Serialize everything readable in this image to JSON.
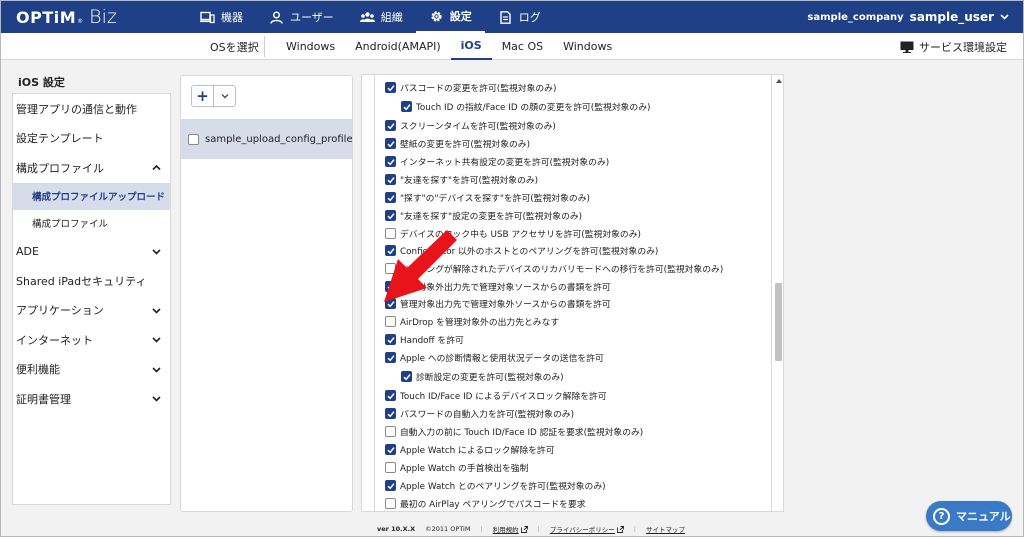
{
  "brand": {
    "optim": "OPTiM",
    "tm": "®",
    "biz": "Biz"
  },
  "nav": [
    {
      "label": "機器",
      "icon": "device-icon"
    },
    {
      "label": "ユーザー",
      "icon": "user-icon"
    },
    {
      "label": "組織",
      "icon": "organization-icon"
    },
    {
      "label": "設定",
      "icon": "gear-icon",
      "active": true
    },
    {
      "label": "ログ",
      "icon": "document-icon"
    }
  ],
  "account": {
    "company": "sample_company",
    "user": "sample_user"
  },
  "subnav": {
    "os_select_label": "OSを選択",
    "tabs": [
      "Windows",
      "Android(AMAPI)",
      "iOS",
      "Mac OS",
      "Windows"
    ],
    "active_tab": "iOS",
    "service_settings": "サービス環境設定"
  },
  "sidebar": {
    "title": "iOS 設定",
    "items": [
      {
        "label": "管理アプリの通信と動作"
      },
      {
        "label": "設定テンプレート"
      },
      {
        "label": "構成プロファイル",
        "expanded": true
      },
      {
        "label": "構成プロファイルアップロード",
        "sub": true,
        "active": true
      },
      {
        "label": "構成プロファイル",
        "sub": true
      },
      {
        "label": "ADE"
      },
      {
        "label": "Shared iPadセキュリティ"
      },
      {
        "label": "アプリケーション"
      },
      {
        "label": "インターネット"
      },
      {
        "label": "便利機能"
      },
      {
        "label": "証明書管理"
      }
    ]
  },
  "files": {
    "add_label": "+",
    "items": [
      {
        "name": "sample_upload_config_profile",
        "checked": false
      }
    ]
  },
  "options": [
    {
      "label": "パスコードの変更を許可(監視対象のみ)",
      "checked": true,
      "indent": 0
    },
    {
      "label": "Touch ID の指紋/Face ID の顔の変更を許可(監視対象のみ)",
      "checked": true,
      "indent": 1
    },
    {
      "label": "スクリーンタイムを許可(監視対象のみ)",
      "checked": true,
      "indent": 0
    },
    {
      "label": "壁紙の変更を許可(監視対象のみ)",
      "checked": true,
      "indent": 0
    },
    {
      "label": "インターネット共有設定の変更を許可(監視対象のみ)",
      "checked": true,
      "indent": 0
    },
    {
      "label": "\"友達を探す\"を許可(監視対象のみ)",
      "checked": true,
      "indent": 0
    },
    {
      "label": "\"探す\"の\"デバイスを探す\"を許可(監視対象のみ)",
      "checked": true,
      "indent": 0
    },
    {
      "label": "\"友達を探す\"設定の変更を許可(監視対象のみ)",
      "checked": true,
      "indent": 0
    },
    {
      "label": "デバイスのロック中も USB アクセサリを許可(監視対象のみ)",
      "checked": false,
      "indent": 0
    },
    {
      "label": "Configurator 以外のホストとのペアリングを許可(監視対象のみ)",
      "checked": true,
      "indent": 0
    },
    {
      "label": "ペアリングが解除されたデバイスのリカバリモードへの移行を許可(監視対象のみ)",
      "checked": false,
      "indent": 0
    },
    {
      "label": "管理対象外出力先で管理対象ソースからの書類を許可",
      "checked": true,
      "indent": 0
    },
    {
      "label": "管理対象出力先で管理対象外ソースからの書類を許可",
      "checked": true,
      "indent": 0
    },
    {
      "label": "AirDrop を管理対象外の出力先とみなす",
      "checked": false,
      "indent": 0
    },
    {
      "label": "Handoff を許可",
      "checked": true,
      "indent": 0
    },
    {
      "label": "Apple への診断情報と使用状況データの送信を許可",
      "checked": true,
      "indent": 0
    },
    {
      "label": "診断設定の変更を許可(監視対象のみ)",
      "checked": true,
      "indent": 1
    },
    {
      "label": "Touch ID/Face ID によるデバイスロック解除を許可",
      "checked": true,
      "indent": 0
    },
    {
      "label": "パスワードの自動入力を許可(監視対象のみ)",
      "checked": true,
      "indent": 0
    },
    {
      "label": "自動入力の前に Touch ID/Face ID 認証を要求(監視対象のみ)",
      "checked": false,
      "indent": 0
    },
    {
      "label": "Apple Watch によるロック解除を許可",
      "checked": true,
      "indent": 0
    },
    {
      "label": "Apple Watch の手首検出を強制",
      "checked": false,
      "indent": 0
    },
    {
      "label": "Apple Watch とのペアリングを許可(監視対象のみ)",
      "checked": true,
      "indent": 0
    },
    {
      "label": "最初の AirPlay ペアリングでパスコードを要求",
      "checked": false,
      "indent": 0
    }
  ],
  "footer": {
    "version": "ver 10.X.X",
    "copyright": "©2011 OPTiM",
    "terms": "利用規約",
    "privacy": "プライバシーポリシー",
    "sitemap": "サイトマップ"
  },
  "manual_button": "マニュアル",
  "colors": {
    "brand": "#1f3f86",
    "accent": "#3a79c6",
    "selected_bg": "#d7dceb",
    "annotation": "#e8141b"
  }
}
